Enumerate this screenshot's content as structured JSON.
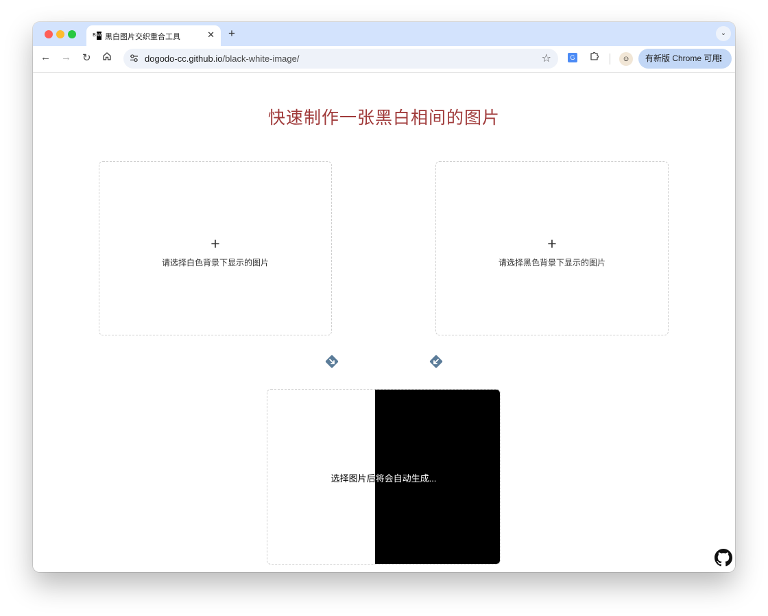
{
  "browser": {
    "tab_title": "黑白图片交织重合工具",
    "tab_favicon_left": "B",
    "tab_favicon_right": "W",
    "tab_close": "✕",
    "new_tab": "+",
    "tab_menu": "⌄",
    "url_host": "dogodo-cc.github.io",
    "url_path": "/black-white-image/",
    "update_button": "有新版 Chrome 可用",
    "update_menu": "⋮"
  },
  "page": {
    "heading": "快速制作一张黑白相间的图片",
    "upload_white": {
      "plus": "+",
      "label": "请选择白色背景下显示的图片"
    },
    "upload_black": {
      "plus": "+",
      "label": "请选择黑色背景下显示的图片"
    },
    "result_text_dark": "选择图片后",
    "result_text_light": "将会自动生成...",
    "colors": {
      "heading": "#a03a3a",
      "arrow": "#5b7c99",
      "result_black": "#000000"
    }
  },
  "icons": {
    "back": "arrow-left-icon",
    "forward": "arrow-right-icon",
    "reload": "reload-icon",
    "home": "home-icon",
    "site_settings": "tune-icon",
    "bookmark": "star-icon",
    "translate": "translate-icon",
    "extensions": "puzzle-icon",
    "github": "github-icon"
  }
}
